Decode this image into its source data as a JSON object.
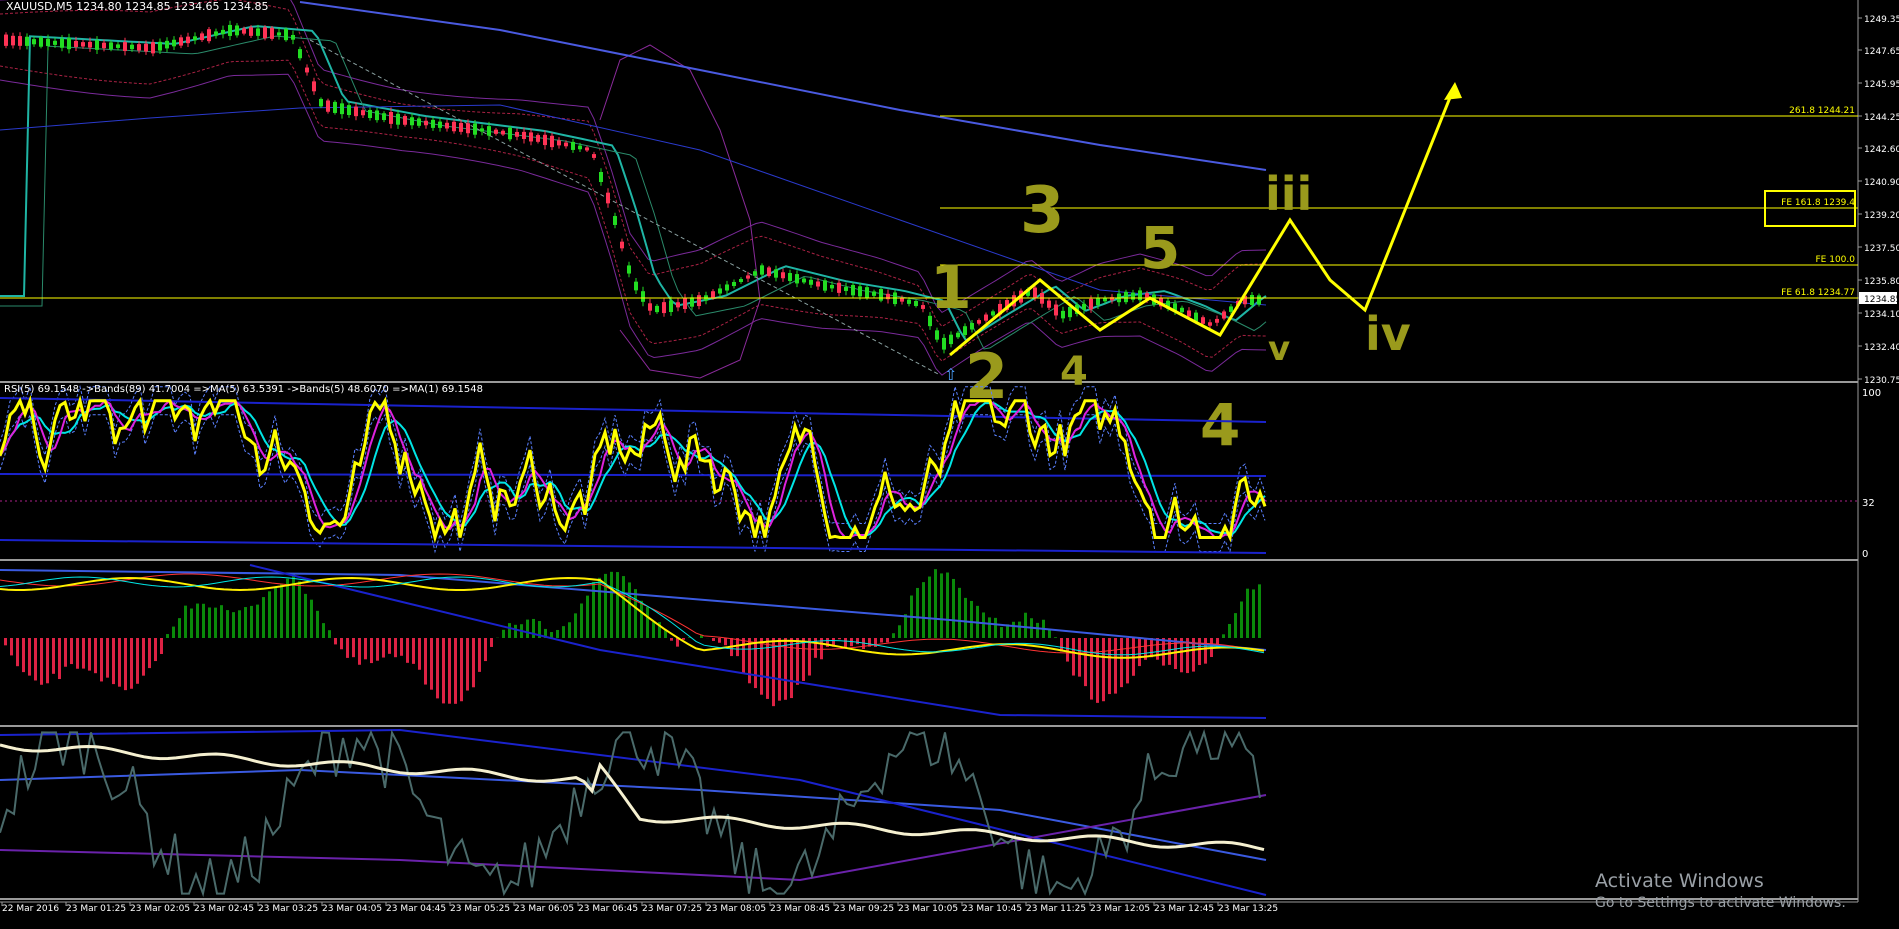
{
  "window": {
    "title": "XAUUSD,M5  1234.80 1234.85 1234.65 1234.85"
  },
  "rsi_panel": {
    "label": "RSI(5) 69.1548  ->Bands(89) 41.7004  =>MA(5) 63.5391  ->Bands(5) 48.6070  =>MA(1) 69.1548",
    "scale": [
      "100",
      "32",
      "0"
    ]
  },
  "price_axis": {
    "ticks": [
      "1249.35",
      "1247.65",
      "1245.95",
      "1244.25",
      "1242.60",
      "1240.90",
      "1239.20",
      "1237.50",
      "1235.80",
      "1234.85",
      "1234.10",
      "1232.40",
      "1230.75"
    ]
  },
  "time_axis": {
    "ticks": [
      "22 Mar 2016",
      "23 Mar 01:25",
      "23 Mar 02:05",
      "23 Mar 02:45",
      "23 Mar 03:25",
      "23 Mar 04:05",
      "23 Mar 04:45",
      "23 Mar 05:25",
      "23 Mar 06:05",
      "23 Mar 06:45",
      "23 Mar 07:25",
      "23 Mar 08:05",
      "23 Mar 08:45",
      "23 Mar 09:25",
      "23 Mar 10:05",
      "23 Mar 10:45",
      "23 Mar 11:25",
      "23 Mar 12:05",
      "23 Mar 12:45",
      "23 Mar 13:25"
    ]
  },
  "fib_levels": [
    {
      "label": "261.8 1244.21"
    },
    {
      "label": "FE 161.8 1239.4"
    },
    {
      "label": "FE 100.0"
    },
    {
      "label": "FE 61.8 1234.77"
    }
  ],
  "wave_labels": [
    "1",
    "2",
    "3",
    "4",
    "5",
    "4",
    "iii",
    "iv",
    "v"
  ],
  "os_notice": {
    "line1": "Activate Windows",
    "line2": "Go to Settings to activate Windows."
  },
  "colors": {
    "background": "#000000",
    "bull_candle": "#22dd22",
    "bear_candle": "#ff3355",
    "fib_line": "#ffff00",
    "rsi_line": "#ffff00",
    "ma_cyan": "#00e5e5",
    "ma_blue": "#2233ff",
    "histogram_up": "#0a8a0a",
    "histogram_down": "#dd2244",
    "wave_annotation": "#9a9a1c"
  }
}
